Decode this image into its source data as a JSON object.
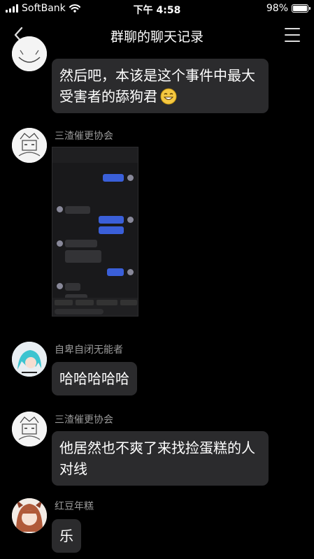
{
  "status_bar": {
    "carrier": "SoftBank",
    "time": "下午 4:58",
    "battery_percent": "98%",
    "battery_level": 0.98,
    "icons": [
      "signal-icon",
      "wifi-icon",
      "battery-icon"
    ]
  },
  "nav": {
    "title": "群聊的聊天记录",
    "back_icon": "chevron-left-icon",
    "menu_icon": "hamburger-menu-icon"
  },
  "messages": [
    {
      "sender": "",
      "type": "text",
      "lines": [
        "然后吧，本该是这个事件中最大",
        "受害者的舔狗君"
      ],
      "emoji": "grin-emoji-icon"
    },
    {
      "sender": "三渣催更协会",
      "type": "image"
    },
    {
      "sender": "自卑自闭无能者",
      "type": "text",
      "lines": [
        "哈哈哈哈哈"
      ]
    },
    {
      "sender": "三渣催更协会",
      "type": "text",
      "lines": [
        "他居然也不爽了来找捡蛋糕的人",
        "对线"
      ]
    },
    {
      "sender": "红豆年糕",
      "type": "text",
      "lines": [
        "乐"
      ]
    }
  ],
  "colors": {
    "background": "#000000",
    "bubble": "#2b2b2d",
    "sender_name": "#9a9a9a",
    "screenshot_outgoing": "#3a5fd9"
  }
}
